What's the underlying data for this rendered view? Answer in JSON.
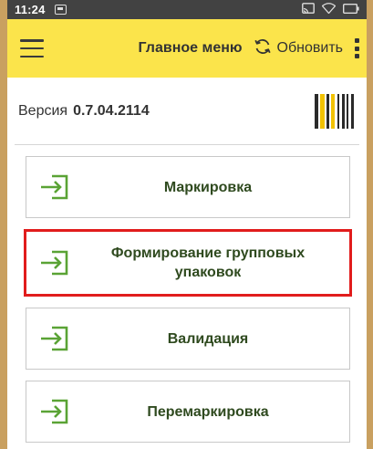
{
  "statusbar": {
    "time": "11:24",
    "icons": [
      "notification-icon",
      "cast-icon",
      "wifi-icon",
      "battery-icon"
    ]
  },
  "appbar": {
    "title": "Главное меню",
    "refresh_label": "Обновить",
    "color": "#fbe44b"
  },
  "version": {
    "label": "Версия",
    "value": "0.7.04.2114"
  },
  "menu": {
    "items": [
      {
        "label": "Маркировка",
        "icon": "login-arrow-icon",
        "selected": false
      },
      {
        "label": "Формирование групповых упаковок",
        "icon": "login-arrow-icon",
        "selected": true
      },
      {
        "label": "Валидация",
        "icon": "login-arrow-icon",
        "selected": false
      },
      {
        "label": "Перемаркировка",
        "icon": "login-arrow-icon",
        "selected": false
      }
    ]
  },
  "colors": {
    "accent_green": "#5aa335",
    "highlight_red": "#e11c1c",
    "label_color": "#2f4a1f"
  }
}
